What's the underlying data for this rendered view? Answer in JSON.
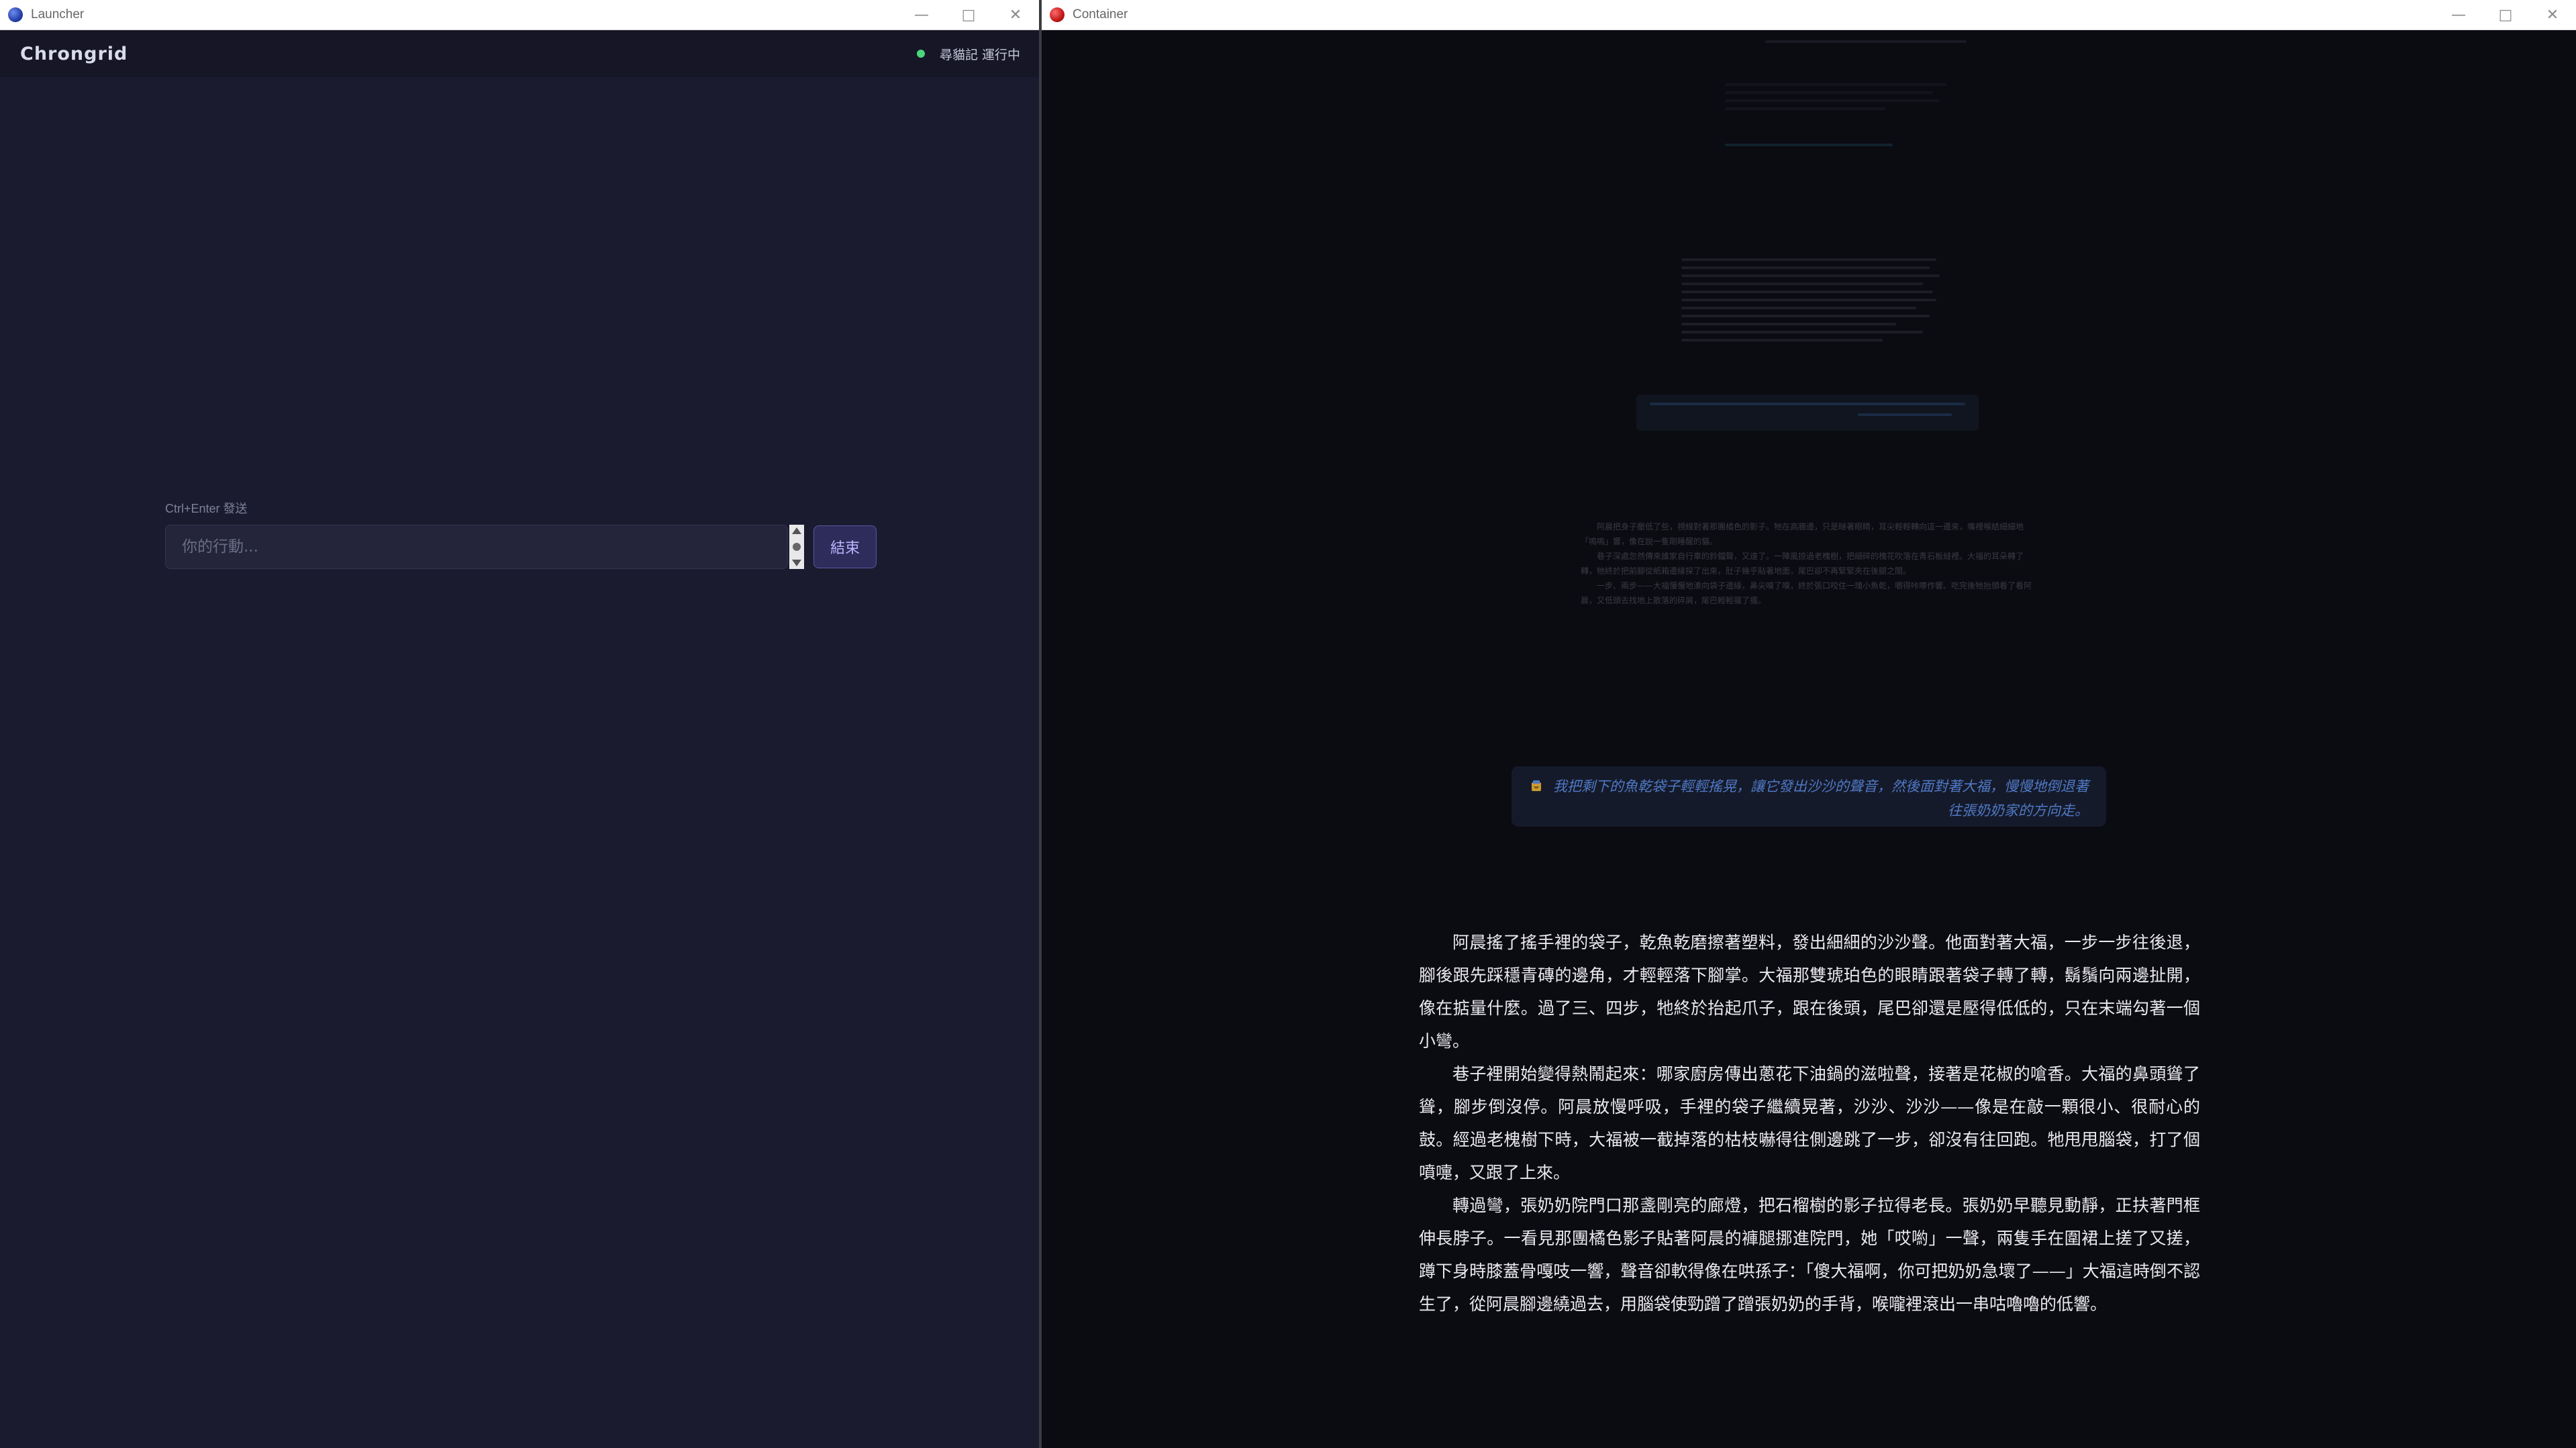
{
  "launcher_window": {
    "title": "Launcher",
    "controls": {
      "minimize": "—",
      "maximize": "□",
      "close": "✕"
    },
    "app": {
      "brand": "Chrongrid",
      "status_text": "尋貓記 運行中",
      "status_color": "#4cd67c"
    },
    "input": {
      "hint": "Ctrl+Enter 發送",
      "placeholder": "你的行動...",
      "value": "",
      "end_button": "結束"
    }
  },
  "container_window": {
    "title": "Container",
    "controls": {
      "minimize": "—",
      "maximize": "□",
      "close": "✕"
    },
    "player_action": "我把剩下的魚乾袋子輕輕搖晃，讓它發出沙沙的聲音，然後面對著大福，慢慢地倒退著往張奶奶家的方向走。",
    "story_paragraphs": [
      "阿晨搖了搖手裡的袋子，乾魚乾磨擦著塑料，發出細細的沙沙聲。他面對著大福，一步一步往後退，腳後跟先踩穩青磚的邊角，才輕輕落下腳掌。大福那雙琥珀色的眼睛跟著袋子轉了轉，鬍鬚向兩邊扯開，像在掂量什麼。過了三、四步，牠終於抬起爪子，跟在後頭，尾巴卻還是壓得低低的，只在末端勾著一個小彎。",
      "巷子裡開始變得熱鬧起來：哪家廚房傳出蔥花下油鍋的滋啦聲，接著是花椒的嗆香。大福的鼻頭聳了聳，腳步倒沒停。阿晨放慢呼吸，手裡的袋子繼續晃著，沙沙、沙沙——像是在敲一顆很小、很耐心的鼓。經過老槐樹下時，大福被一截掉落的枯枝嚇得往側邊跳了一步，卻沒有往回跑。牠甩甩腦袋，打了個噴嚏，又跟了上來。",
      "轉過彎，張奶奶院門口那盞剛亮的廊燈，把石榴樹的影子拉得老長。張奶奶早聽見動靜，正扶著門框伸長脖子。一看見那團橘色影子貼著阿晨的褲腿挪進院門，她「哎喲」一聲，兩隻手在圍裙上搓了又搓，蹲下身時膝蓋骨嘎吱一響，聲音卻軟得像在哄孫子：「傻大福啊，你可把奶奶急壞了——」大福這時倒不認生了，從阿晨腳邊繞過去，用腦袋使勁蹭了蹭張奶奶的手背，喉嚨裡滾出一串咕嚕嚕的低響。"
    ],
    "faded_history": {
      "earlier_action": "我輕輕把魚乾放在地上，往後退了兩步，然後蹲下來等著牠自己過來。",
      "earlier_paragraphs": [
        "阿晨把身子壓低了些，視線對著那團橘色的影子。牠在高牆邊，只是瞇著眼睛，耳尖輕輕轉向這一邊來，嘴裡喉結細細地「嗚嗚」響，像在說一隻剛睡醒的貓。",
        "巷子深處忽然傳來誰家自行車的鈴鐺聲，又遠了。一陣風掠過老槐樹，把細碎的槐花吹落在青石板縫裡。大福的耳朵轉了轉，牠終於把前腳從紙箱邊緣探了出來，肚子幾乎貼著地面，尾巴卻不再緊緊夾在後腿之間。",
        "一步、兩步——大福慢慢地湊向袋子邊緣，鼻尖嗅了嗅，終於張口咬住一塊小魚乾，嚼得咔嚓作響。吃完後牠抬頭看了看阿晨，又低頭去找地上散落的碎屑，尾巴輕輕擺了擺。"
      ]
    }
  },
  "colors": {
    "launcher_bg": "#1a1b2f",
    "container_bg": "#0b0b12",
    "accent_button": "#b9b6ff",
    "player_action_text": "#4f79c6"
  }
}
